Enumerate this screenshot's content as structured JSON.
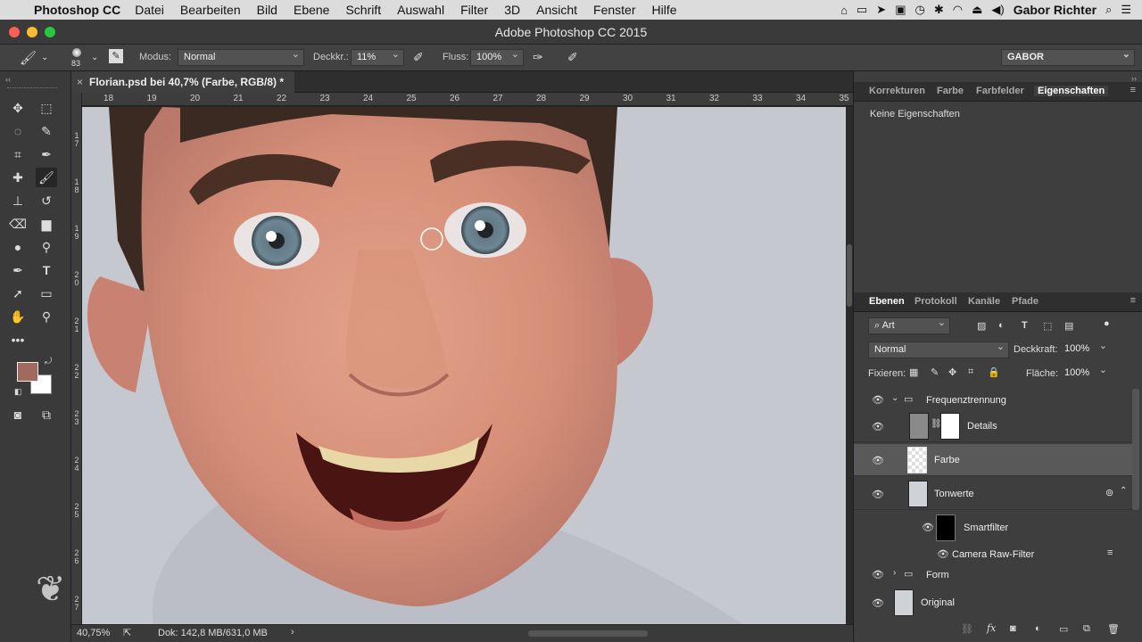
{
  "menubar": {
    "app": "Photoshop CC",
    "items": [
      "Datei",
      "Bearbeiten",
      "Bild",
      "Ebene",
      "Schrift",
      "Auswahl",
      "Filter",
      "3D",
      "Ansicht",
      "Fenster",
      "Hilfe"
    ],
    "user": "Gabor Richter"
  },
  "window": {
    "title": "Adobe Photoshop CC 2015"
  },
  "options": {
    "brush_size": "83",
    "modus_label": "Modus:",
    "modus_value": "Normal",
    "deckkr_label": "Deckkr.:",
    "deckkr_value": "11%",
    "fluss_label": "Fluss:",
    "fluss_value": "100%",
    "workspace": "GABOR"
  },
  "document": {
    "tab_title": "Florian.psd bei 40,7% (Farbe, RGB/8) *"
  },
  "ruler": {
    "top": [
      "18",
      "19",
      "20",
      "21",
      "22",
      "23",
      "24",
      "25",
      "26",
      "27",
      "28",
      "29",
      "30",
      "31",
      "32",
      "33",
      "34",
      "35"
    ],
    "left": [
      [
        "1",
        "7"
      ],
      [
        "1",
        "8"
      ],
      [
        "1",
        "9"
      ],
      [
        "2",
        "0"
      ],
      [
        "2",
        "1"
      ],
      [
        "2",
        "2"
      ],
      [
        "2",
        "3"
      ],
      [
        "2",
        "4"
      ],
      [
        "2",
        "5"
      ],
      [
        "2",
        "6"
      ],
      [
        "2",
        "7"
      ]
    ]
  },
  "status": {
    "zoom": "40,75%",
    "doc": "Dok: 142,8 MB/631,0 MB"
  },
  "properties_panel": {
    "tabs": [
      "Korrekturen",
      "Farbe",
      "Farbfelder",
      "Eigenschaften"
    ],
    "active_tab": "Eigenschaften",
    "empty_text": "Keine Eigenschaften"
  },
  "layers_panel": {
    "tabs": [
      "Ebenen",
      "Protokoll",
      "Kanäle",
      "Pfade"
    ],
    "active_tab": "Ebenen",
    "filter": "Art",
    "blend_mode": "Normal",
    "opacity_label": "Deckkraft:",
    "opacity_value": "100%",
    "lock_label": "Fixieren:",
    "fill_label": "Fläche:",
    "fill_value": "100%",
    "layers": [
      {
        "name": "Frequenztrennung",
        "type": "group-open"
      },
      {
        "name": "Details",
        "type": "layer-mask"
      },
      {
        "name": "Farbe",
        "type": "layer",
        "selected": true
      },
      {
        "name": "Tonwerte",
        "type": "smart"
      },
      {
        "name": "Smartfilter",
        "type": "filter-mask"
      },
      {
        "name": "Camera Raw-Filter",
        "type": "filter"
      },
      {
        "name": "Form",
        "type": "group-closed"
      },
      {
        "name": "Original",
        "type": "smart"
      }
    ]
  },
  "colors": {
    "foreground": "#a06a5e",
    "background": "#ffffff",
    "accent": "#4a4a4a"
  }
}
